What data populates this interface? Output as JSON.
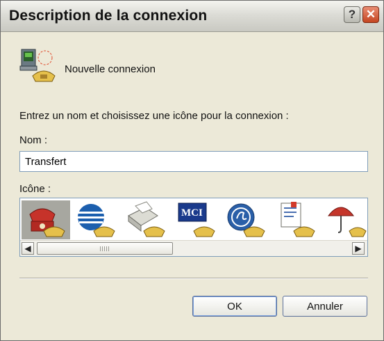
{
  "window": {
    "title": "Description de la connexion",
    "help_glyph": "?",
    "close_glyph": "✕"
  },
  "header": {
    "label": "Nouvelle connexion"
  },
  "instructions": "Entrez un nom et choisissez une icône pour la connexion :",
  "name_field": {
    "label": "Nom :",
    "value": "Transfert"
  },
  "icon_field": {
    "label": "Icône :",
    "icons": [
      "red-phone-icon",
      "globe-icon",
      "fax-icon",
      "mci-icon",
      "ge-icon",
      "document-icon",
      "umbrella-icon"
    ],
    "selected_index": 0
  },
  "scrollbar": {
    "left_arrow": "◀",
    "right_arrow": "▶"
  },
  "buttons": {
    "ok": "OK",
    "cancel": "Annuler"
  }
}
